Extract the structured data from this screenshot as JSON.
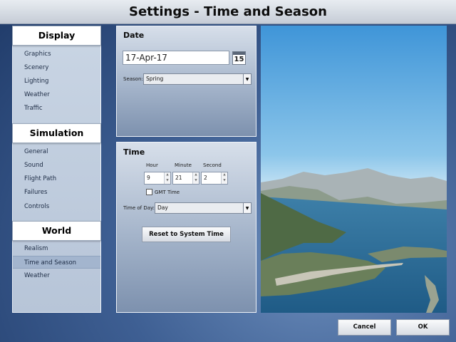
{
  "window": {
    "title": "Settings - Time and Season"
  },
  "sidebar": {
    "categories": [
      {
        "title": "Display",
        "items": [
          "Graphics",
          "Scenery",
          "Lighting",
          "Weather",
          "Traffic"
        ]
      },
      {
        "title": "Simulation",
        "items": [
          "General",
          "Sound",
          "Flight Path",
          "Failures",
          "Controls"
        ]
      },
      {
        "title": "World",
        "items": [
          "Realism",
          "Time and Season",
          "Weather"
        ]
      }
    ],
    "selected_item": "Time and Season"
  },
  "date_panel": {
    "title": "Date",
    "date_value": "17-Apr-17",
    "calendar_day": "15",
    "season_label": "Season:",
    "season_value": "Spring"
  },
  "time_panel": {
    "title": "Time",
    "hour_label": "Hour",
    "minute_label": "Minute",
    "second_label": "Second",
    "hour_value": "9",
    "minute_value": "21",
    "second_value": "2",
    "gmt_label": "GMT Time",
    "gmt_checked": false,
    "time_of_day_label": "Time of Day:",
    "time_of_day_value": "Day",
    "reset_label": "Reset to System Time"
  },
  "footer": {
    "cancel_label": "Cancel",
    "ok_label": "OK"
  },
  "icons": {
    "calendar": "calendar-icon",
    "dropdown": "chevron-down-icon",
    "spin_up": "chevron-up-icon",
    "spin_down": "chevron-down-icon"
  },
  "colors": {
    "background": "#3e5f93",
    "selected_item": "#a3b5ce",
    "panel_top": "#d7dfea",
    "header_bg": "#ffffff"
  }
}
